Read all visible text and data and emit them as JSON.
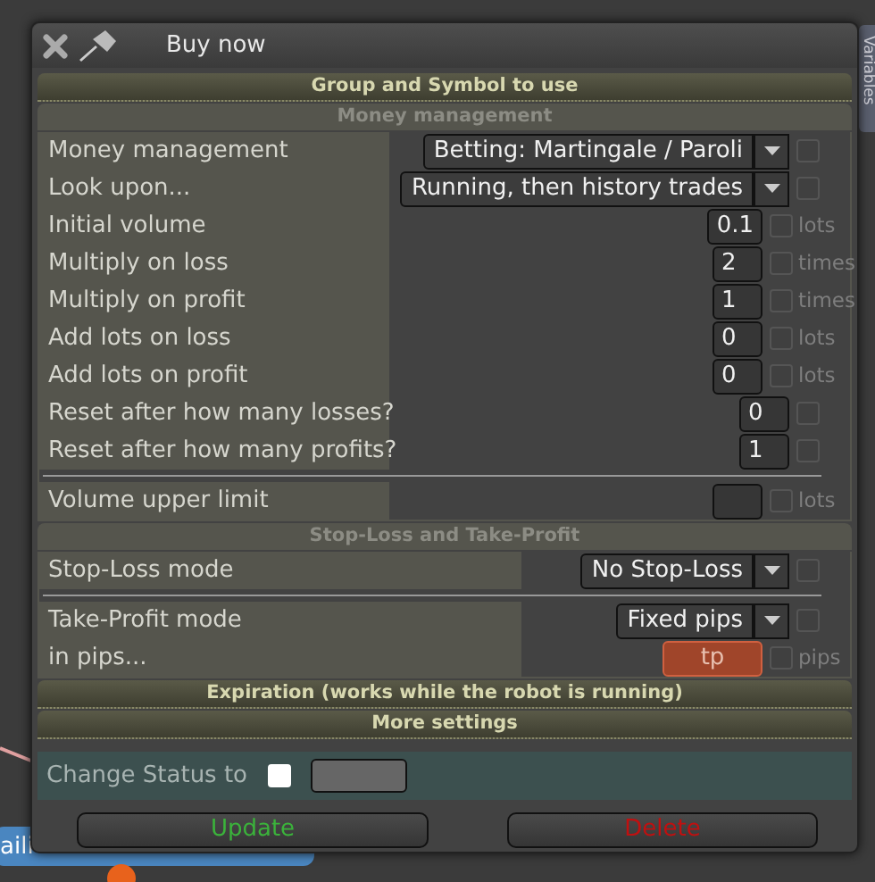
{
  "window": {
    "title": "Buy now"
  },
  "side_tab": {
    "label": "Variables"
  },
  "chart_label": {
    "text": "aili"
  },
  "sections": [
    {
      "title": "Group and Symbol to use",
      "expanded": false
    },
    {
      "title": "Money management",
      "expanded": true,
      "rows": [
        {
          "label": "Money management",
          "kind": "select",
          "value": "Betting: Martingale / Paroli",
          "checked": false,
          "divider_before": false
        },
        {
          "label": "Look upon...",
          "kind": "select",
          "value": "Running, then history trades",
          "checked": false,
          "divider_before": false
        },
        {
          "label": "Initial volume",
          "kind": "number",
          "value": "0.1",
          "unit": "lots",
          "checked": false,
          "divider_before": false
        },
        {
          "label": "Multiply on loss",
          "kind": "number",
          "value": "2",
          "unit": "times",
          "checked": false,
          "divider_before": false
        },
        {
          "label": "Multiply on profit",
          "kind": "number",
          "value": "1",
          "unit": "times",
          "checked": false,
          "divider_before": false
        },
        {
          "label": "Add lots on loss",
          "kind": "number",
          "value": "0",
          "unit": "lots",
          "checked": false,
          "divider_before": false
        },
        {
          "label": "Add lots on profit",
          "kind": "number",
          "value": "0",
          "unit": "lots",
          "checked": false,
          "divider_before": false
        },
        {
          "label": "Reset after how many losses?",
          "kind": "number",
          "value": "0",
          "checked": false,
          "divider_before": false
        },
        {
          "label": "Reset after how many profits?",
          "kind": "number",
          "value": "1",
          "checked": false,
          "divider_before": false
        },
        {
          "label": "Volume upper limit",
          "kind": "number",
          "unit": "lots",
          "checked": false,
          "divider_before": true
        }
      ]
    },
    {
      "title": "Stop-Loss and Take-Profit",
      "expanded": true,
      "rows": [
        {
          "label": "Stop-Loss mode",
          "kind": "select",
          "value": "No Stop-Loss",
          "checked": false,
          "divider_before": false
        },
        {
          "label": "Take-Profit mode",
          "kind": "select",
          "value": "Fixed pips",
          "checked": false,
          "divider_before": true
        },
        {
          "label": "in pips...",
          "kind": "number",
          "value": "tp",
          "highlighted": true,
          "unit": "pips",
          "checked": false,
          "divider_before": false
        }
      ]
    },
    {
      "title": "Expiration (works while the robot is running)",
      "expanded": false
    },
    {
      "title": "More settings",
      "expanded": false
    }
  ],
  "status": {
    "label": "Change Status to",
    "checked": false
  },
  "buttons": [
    {
      "label": "Update",
      "kind": "confirm"
    },
    {
      "label": "Delete",
      "kind": "danger"
    }
  ]
}
